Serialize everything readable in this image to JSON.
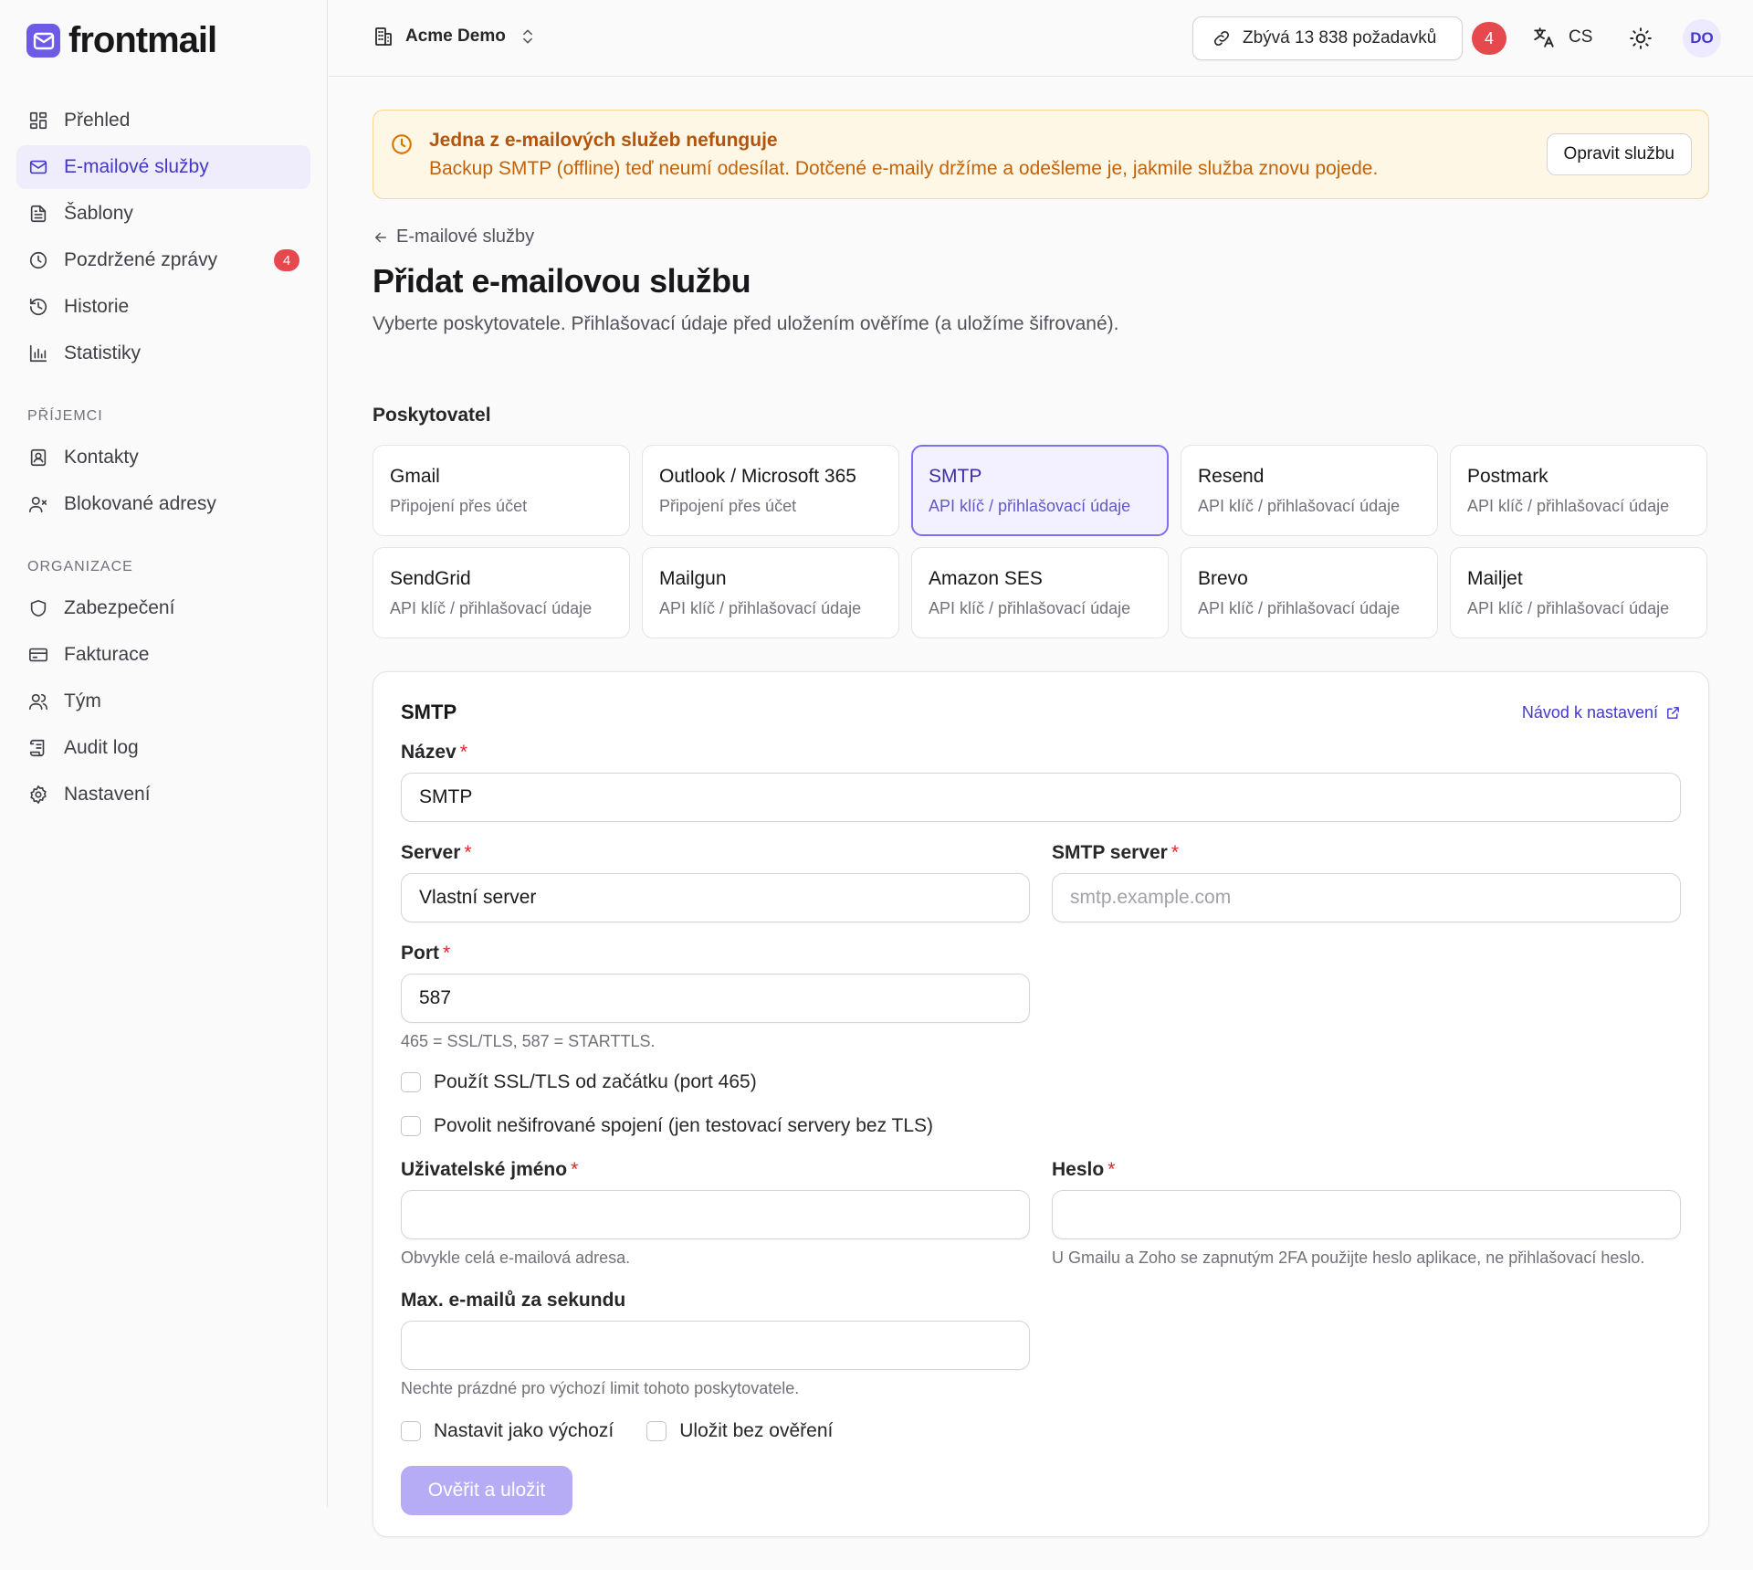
{
  "app": {
    "logo_text": "frontmail"
  },
  "sidebar": {
    "items": [
      {
        "label": "Přehled"
      },
      {
        "label": "E-mailové služby"
      },
      {
        "label": "Šablony"
      },
      {
        "label": "Pozdržené zprávy",
        "badge": "4"
      },
      {
        "label": "Historie"
      },
      {
        "label": "Statistiky"
      }
    ],
    "section_recipients": "PŘÍJEMCI",
    "recipients": [
      {
        "label": "Kontakty"
      },
      {
        "label": "Blokované adresy"
      }
    ],
    "section_org": "ORGANIZACE",
    "org": [
      {
        "label": "Zabezpečení"
      },
      {
        "label": "Fakturace"
      },
      {
        "label": "Tým"
      },
      {
        "label": "Audit log"
      },
      {
        "label": "Nastavení"
      }
    ]
  },
  "header": {
    "org_name": "Acme Demo",
    "quota": "Zbývá 13 838 požadavků",
    "badge": "4",
    "lang": "CS",
    "avatar": "DO"
  },
  "alert": {
    "title": "Jedna z e-mailových služeb nefunguje",
    "text": "Backup SMTP (offline) teď neumí odesílat. Dotčené e-maily držíme a odešleme je, jakmile služba znovu pojede.",
    "button": "Opravit službu"
  },
  "page": {
    "back": "E-mailové služby",
    "title": "Přidat e-mailovou službu",
    "subtitle": "Vyberte poskytovatele. Přihlašovací údaje před uložením ověříme (a uložíme šifrované)."
  },
  "providers": {
    "label": "Poskytovatel",
    "items": [
      {
        "name": "Gmail",
        "desc": "Připojení přes účet"
      },
      {
        "name": "Outlook / Microsoft 365",
        "desc": "Připojení přes účet"
      },
      {
        "name": "SMTP",
        "desc": "API klíč / přihlašovací údaje"
      },
      {
        "name": "Resend",
        "desc": "API klíč / přihlašovací údaje"
      },
      {
        "name": "Postmark",
        "desc": "API klíč / přihlašovací údaje"
      },
      {
        "name": "SendGrid",
        "desc": "API klíč / přihlašovací údaje"
      },
      {
        "name": "Mailgun",
        "desc": "API klíč / přihlašovací údaje"
      },
      {
        "name": "Amazon SES",
        "desc": "API klíč / přihlašovací údaje"
      },
      {
        "name": "Brevo",
        "desc": "API klíč / přihlašovací údaje"
      },
      {
        "name": "Mailjet",
        "desc": "API klíč / přihlašovací údaje"
      }
    ]
  },
  "form": {
    "title": "SMTP",
    "guide_link": "Návod k nastavení",
    "name": {
      "label": "Název",
      "value": "SMTP"
    },
    "server": {
      "label": "Server",
      "value": "Vlastní server"
    },
    "smtp_server": {
      "label": "SMTP server",
      "placeholder": "smtp.example.com"
    },
    "port": {
      "label": "Port",
      "value": "587",
      "hint": "465 = SSL/TLS, 587 = STARTTLS."
    },
    "ssl_checkbox": "Použít SSL/TLS od začátku (port 465)",
    "insecure_checkbox": "Povolit nešifrované spojení (jen testovací servery bez TLS)",
    "username": {
      "label": "Uživatelské jméno",
      "value": "",
      "hint": "Obvykle celá e-mailová adresa."
    },
    "password": {
      "label": "Heslo",
      "value": "",
      "hint": "U Gmailu a Zoho se zapnutým 2FA použijte heslo aplikace, ne přihlašovací heslo."
    },
    "rate": {
      "label": "Max. e-mailů za sekundu",
      "value": "",
      "hint": "Nechte prázdné pro výchozí limit tohoto poskytovatele."
    },
    "default_checkbox": "Nastavit jako výchozí",
    "noverify_checkbox": "Uložit bez ověření",
    "submit": "Ověřit a uložit",
    "required_mark": "*"
  },
  "colors": {
    "accent": "#4338ca",
    "brand": "#6d5ae6",
    "warning_bg": "#fff7e6",
    "danger": "#e5484d"
  }
}
